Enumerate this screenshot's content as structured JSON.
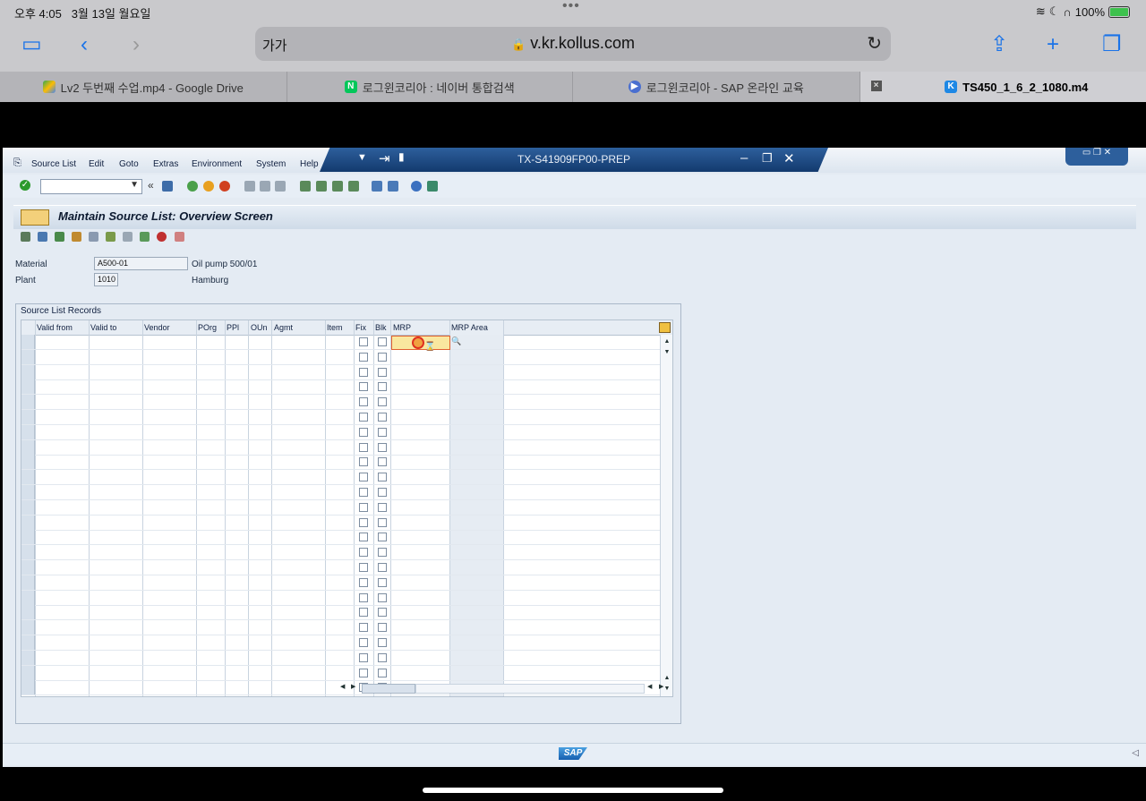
{
  "status": {
    "time": "오후 4:05",
    "date": "3월 13일 월요일",
    "battery": "100%"
  },
  "browser": {
    "text_size": "가가",
    "url": "v.kr.kollus.com"
  },
  "tabs": [
    {
      "label": "Lv2 두번째 수업.mp4 - Google Drive"
    },
    {
      "label": "로그윈코리아 : 네이버 통합검색"
    },
    {
      "label": "로그윈코리아 - SAP 온라인 교육"
    },
    {
      "label": "TS450_1_6_2_1080.m4"
    }
  ],
  "sap": {
    "menu": [
      "Source List",
      "Edit",
      "Goto",
      "Extras",
      "Environment",
      "System",
      "Help"
    ],
    "system_title": "TX-S41909FP00-PREP",
    "screen_title": "Maintain Source List: Overview Screen",
    "material_label": "Material",
    "material_value": "A500-01",
    "material_desc": "Oil pump 500/01",
    "plant_label": "Plant",
    "plant_value": "1010",
    "plant_desc": "Hamburg",
    "group_title": "Source List Records",
    "columns": [
      "Valid from",
      "Valid to",
      "Vendor",
      "POrg",
      "PPl",
      "OUn",
      "Agmt",
      "Item",
      "Fix",
      "Blk",
      "MRP",
      "MRP Area"
    ],
    "footer_logo": "SAP"
  }
}
